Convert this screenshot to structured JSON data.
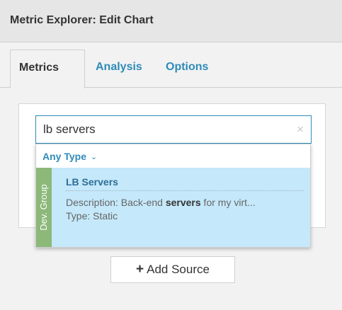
{
  "window": {
    "title": "Metric Explorer: Edit Chart"
  },
  "tabs": [
    {
      "label": "Metrics",
      "active": true
    },
    {
      "label": "Analysis",
      "active": false
    },
    {
      "label": "Options",
      "active": false
    }
  ],
  "search": {
    "value": "lb servers",
    "clear_icon": "×"
  },
  "dropdown": {
    "type_filter_label": "Any Type",
    "type_filter_chevron": "⌄",
    "results": [
      {
        "group": "Dev. Group",
        "title": "LB Servers",
        "desc_prefix": "Description: Back-end ",
        "desc_match": "servers",
        "desc_suffix": " for my virt...",
        "type": "Type: Static"
      }
    ]
  },
  "add_source": {
    "icon": "+",
    "label": "Add Source"
  },
  "colors": {
    "accent": "#2e8bb8",
    "result_highlight": "#c5e8fa",
    "group_strip": "#8cb879"
  }
}
